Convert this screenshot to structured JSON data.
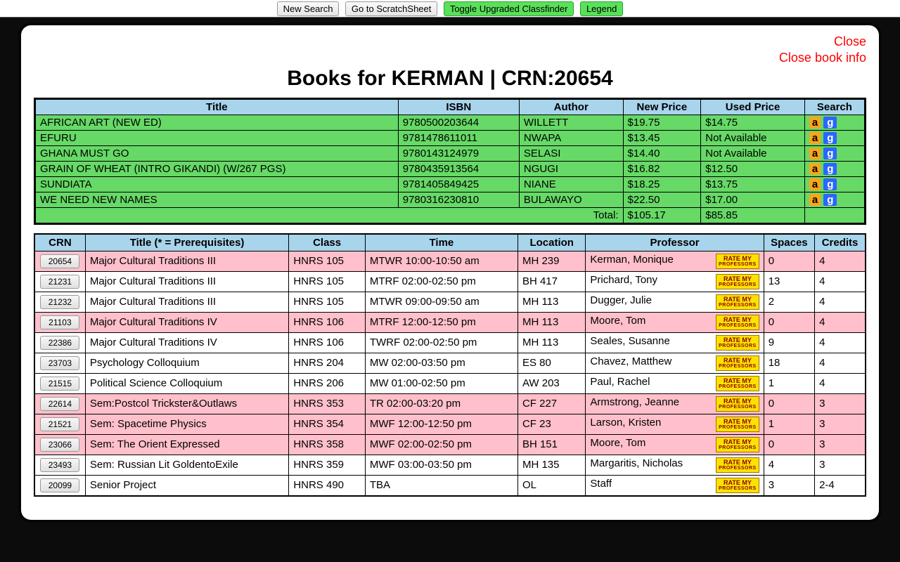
{
  "toolbar": {
    "new_search": "New Search",
    "scratchsheet": "Go to ScratchSheet",
    "toggle": "Toggle Upgraded Classfinder",
    "legend": "Legend"
  },
  "modal": {
    "close": "Close",
    "close_book": "Close book info",
    "title": "Books for KERMAN | CRN:20654"
  },
  "books_headers": {
    "title": "Title",
    "isbn": "ISBN",
    "author": "Author",
    "newp": "New Price",
    "usedp": "Used Price",
    "search": "Search"
  },
  "books": [
    {
      "title": "AFRICAN ART (NEW ED)",
      "isbn": "9780500203644",
      "author": "WILLETT",
      "newp": "$19.75",
      "usedp": "$14.75"
    },
    {
      "title": "EFURU",
      "isbn": "9781478611011",
      "author": "NWAPA",
      "newp": "$13.45",
      "usedp": "Not Available"
    },
    {
      "title": "GHANA MUST GO",
      "isbn": "9780143124979",
      "author": "SELASI",
      "newp": "$14.40",
      "usedp": "Not Available"
    },
    {
      "title": "GRAIN OF WHEAT (INTRO GIKANDI) (W/267 PGS)",
      "isbn": "9780435913564",
      "author": "NGUGI",
      "newp": "$16.82",
      "usedp": "$12.50"
    },
    {
      "title": "SUNDIATA",
      "isbn": "9781405849425",
      "author": "NIANE",
      "newp": "$18.25",
      "usedp": "$13.75"
    },
    {
      "title": "WE NEED NEW NAMES",
      "isbn": "9780316230810",
      "author": "BULAWAYO",
      "newp": "$22.50",
      "usedp": "$17.00"
    }
  ],
  "totals": {
    "label": "Total:",
    "newp": "$105.17",
    "usedp": "$85.85"
  },
  "class_headers": {
    "crn": "CRN",
    "title": "Title (* = Prerequisites)",
    "class": "Class",
    "time": "Time",
    "location": "Location",
    "professor": "Professor",
    "spaces": "Spaces",
    "credits": "Credits"
  },
  "rmp_label": {
    "top": "RATE MY",
    "bot": "PROFESSORS"
  },
  "classes": [
    {
      "crn": "20654",
      "title": "Major Cultural Traditions III",
      "class": "HNRS 105",
      "time": "MTWR 10:00-10:50 am",
      "loc": "MH 239",
      "prof": "Kerman, Monique",
      "spaces": "0",
      "credits": "4",
      "pink": true
    },
    {
      "crn": "21231",
      "title": "Major Cultural Traditions III",
      "class": "HNRS 105",
      "time": "MTRF 02:00-02:50 pm",
      "loc": "BH 417",
      "prof": "Prichard, Tony",
      "spaces": "13",
      "credits": "4",
      "pink": false
    },
    {
      "crn": "21232",
      "title": "Major Cultural Traditions III",
      "class": "HNRS 105",
      "time": "MTWR 09:00-09:50 am",
      "loc": "MH 113",
      "prof": "Dugger, Julie",
      "spaces": "2",
      "credits": "4",
      "pink": false
    },
    {
      "crn": "21103",
      "title": "Major Cultural Traditions IV",
      "class": "HNRS 106",
      "time": "MTRF 12:00-12:50 pm",
      "loc": "MH 113",
      "prof": "Moore, Tom",
      "spaces": "0",
      "credits": "4",
      "pink": true
    },
    {
      "crn": "22386",
      "title": "Major Cultural Traditions IV",
      "class": "HNRS 106",
      "time": "TWRF 02:00-02:50 pm",
      "loc": "MH 113",
      "prof": "Seales, Susanne",
      "spaces": "9",
      "credits": "4",
      "pink": false
    },
    {
      "crn": "23703",
      "title": "Psychology Colloquium",
      "class": "HNRS 204",
      "time": "MW 02:00-03:50 pm",
      "loc": "ES 80",
      "prof": "Chavez, Matthew",
      "spaces": "18",
      "credits": "4",
      "pink": false
    },
    {
      "crn": "21515",
      "title": "Political Science Colloquium",
      "class": "HNRS 206",
      "time": "MW 01:00-02:50 pm",
      "loc": "AW 203",
      "prof": "Paul, Rachel",
      "spaces": "1",
      "credits": "4",
      "pink": false
    },
    {
      "crn": "22614",
      "title": "Sem:Postcol Trickster&Outlaws",
      "class": "HNRS 353",
      "time": "TR 02:00-03:20 pm",
      "loc": "CF 227",
      "prof": "Armstrong, Jeanne",
      "spaces": "0",
      "credits": "3",
      "pink": true
    },
    {
      "crn": "21521",
      "title": "Sem: Spacetime Physics",
      "class": "HNRS 354",
      "time": "MWF 12:00-12:50 pm",
      "loc": "CF 23",
      "prof": "Larson, Kristen",
      "spaces": "1",
      "credits": "3",
      "pink": true
    },
    {
      "crn": "23066",
      "title": "Sem: The Orient Expressed",
      "class": "HNRS 358",
      "time": "MWF 02:00-02:50 pm",
      "loc": "BH 151",
      "prof": "Moore, Tom",
      "spaces": "0",
      "credits": "3",
      "pink": true
    },
    {
      "crn": "23493",
      "title": "Sem: Russian Lit GoldentoExile",
      "class": "HNRS 359",
      "time": "MWF 03:00-03:50 pm",
      "loc": "MH 135",
      "prof": "Margaritis, Nicholas",
      "spaces": "4",
      "credits": "3",
      "pink": false
    },
    {
      "crn": "20099",
      "title": "Senior Project",
      "class": "HNRS 490",
      "time": "TBA",
      "loc": "OL",
      "prof": "Staff",
      "spaces": "3",
      "credits": "2-4",
      "pink": false
    }
  ]
}
